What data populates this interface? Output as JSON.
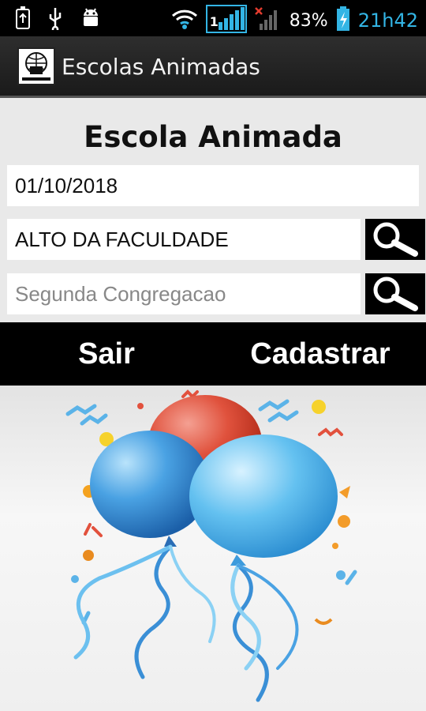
{
  "status_bar": {
    "icons_left": [
      "usb-debug-icon",
      "usb-icon",
      "android-debug-icon"
    ],
    "wifi_indicator": "1",
    "battery_percent": "83%",
    "time": "21h42"
  },
  "action_bar": {
    "app_title": "Escolas Animadas"
  },
  "form": {
    "title": "Escola Animada",
    "date_value": "01/10/2018",
    "school_value": "ALTO DA FACULDADE",
    "congregation_placeholder": "Segunda Congregacao"
  },
  "buttons": {
    "exit_label": "Sair",
    "register_label": "Cadastrar"
  },
  "colors": {
    "accent_blue": "#33b5e5",
    "toolbar_bg": "#222222",
    "button_bar_bg": "#000000"
  }
}
